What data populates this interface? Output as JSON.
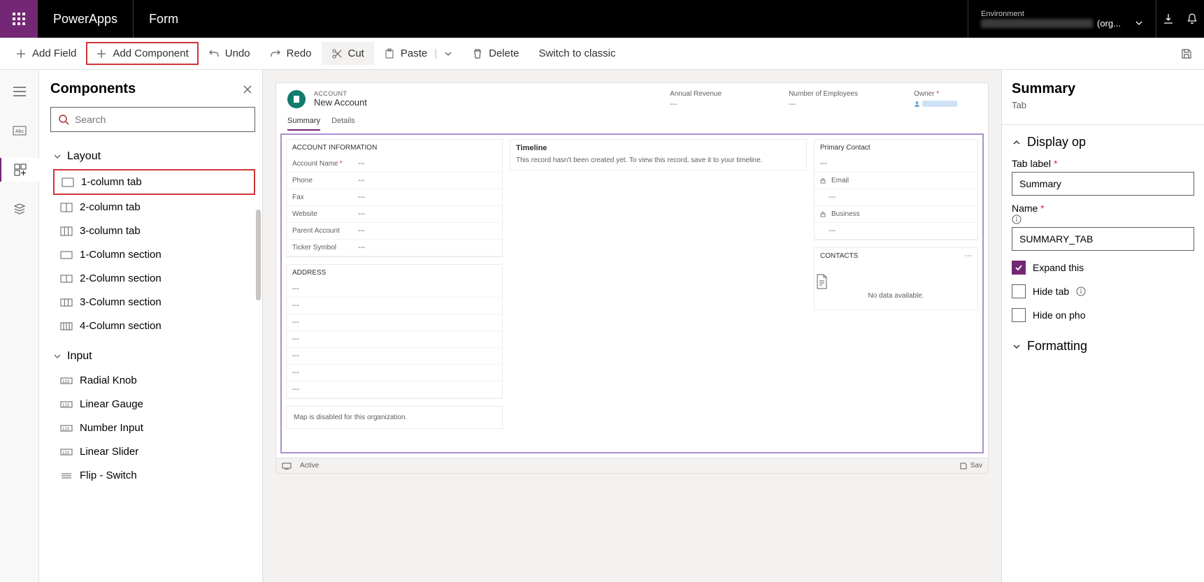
{
  "topbar": {
    "brand": "PowerApps",
    "form_label": "Form",
    "environment_label": "Environment",
    "environment_suffix": "(org..."
  },
  "toolbar": {
    "add_field": "Add Field",
    "add_component": "Add Component",
    "undo": "Undo",
    "redo": "Redo",
    "cut": "Cut",
    "paste": "Paste",
    "delete": "Delete",
    "switch_classic": "Switch to classic"
  },
  "components_panel": {
    "title": "Components",
    "search_placeholder": "Search",
    "groups": {
      "layout": {
        "label": "Layout",
        "items": [
          "1-column tab",
          "2-column tab",
          "3-column tab",
          "1-Column section",
          "2-Column section",
          "3-Column section",
          "4-Column section"
        ]
      },
      "input": {
        "label": "Input",
        "items": [
          "Radial Knob",
          "Linear Gauge",
          "Number Input",
          "Linear Slider",
          "Flip - Switch"
        ]
      }
    }
  },
  "form_canvas": {
    "entity_label": "ACCOUNT",
    "record_title": "New Account",
    "header_fields": [
      {
        "label": "Annual Revenue",
        "value": "---"
      },
      {
        "label": "Number of Employees",
        "value": "---"
      },
      {
        "label": "Owner",
        "value": ""
      }
    ],
    "tabs": [
      "Summary",
      "Details"
    ],
    "account_info_header": "ACCOUNT INFORMATION",
    "account_fields": [
      {
        "label": "Account Name",
        "value": "---",
        "required": true
      },
      {
        "label": "Phone",
        "value": "---"
      },
      {
        "label": "Fax",
        "value": "---"
      },
      {
        "label": "Website",
        "value": "---"
      },
      {
        "label": "Parent Account",
        "value": "---"
      },
      {
        "label": "Ticker Symbol",
        "value": "---"
      }
    ],
    "address_header": "ADDRESS",
    "timeline_header": "Timeline",
    "timeline_msg": "This record hasn't been created yet.  To view this record, save it to your timeline.",
    "primary_contact_label": "Primary Contact",
    "email_label": "Email",
    "business_label": "Business",
    "contacts_header": "CONTACTS",
    "contacts_empty": "No data available.",
    "map_msg": "Map is disabled for this organization.",
    "status_label": "Active",
    "save_label": "Sav"
  },
  "right_panel": {
    "title": "Summary",
    "subtitle": "Tab",
    "display_section": "Display op",
    "tab_label": "Tab label",
    "tab_label_value": "Summary",
    "name_label": "Name",
    "name_value": "SUMMARY_TAB",
    "expand": "Expand this ",
    "hide_tab": "Hide tab",
    "hide_phone": "Hide on pho",
    "formatting_section": "Formatting"
  }
}
